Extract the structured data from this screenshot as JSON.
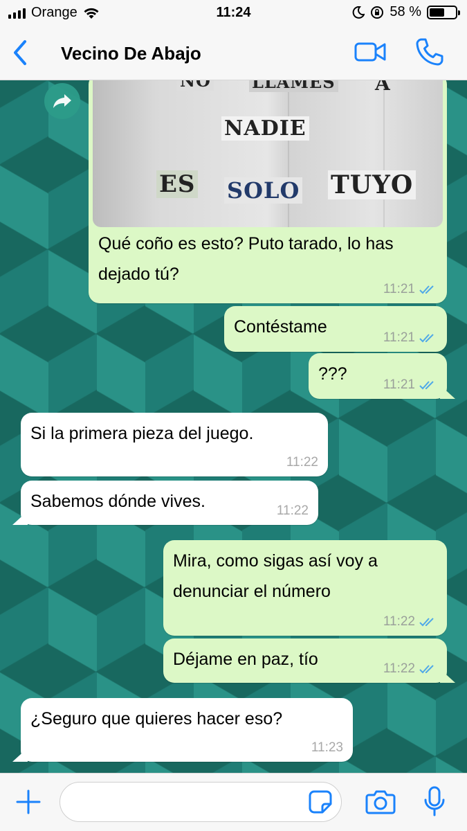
{
  "status_bar": {
    "carrier": "Orange",
    "time": "11:24",
    "battery_text": "58 %",
    "battery_level": 0.58
  },
  "header": {
    "back_icon": "chevron-left-icon",
    "contact_name": "Vecino De Abajo",
    "video_icon": "video-camera-icon",
    "call_icon": "phone-icon",
    "accent": "#1a82fb"
  },
  "image_message": {
    "photo_words": [
      "NO",
      "LLAMES",
      "A",
      "NADIE",
      "ES",
      "SOLO",
      "TUYO"
    ],
    "caption": "Qué coño es esto? Puto tarado, lo has dejado tú?",
    "time": "11:21"
  },
  "messages": [
    {
      "direction": "out",
      "text": "Contéstame",
      "time": "11:21",
      "read": true
    },
    {
      "direction": "out",
      "text": "???",
      "time": "11:21",
      "read": true
    },
    {
      "direction": "in",
      "text": "Si la primera pieza del juego.",
      "time": "11:22"
    },
    {
      "direction": "in",
      "text": "Sabemos dónde vives.",
      "time": "11:22"
    },
    {
      "direction": "out",
      "text": "Mira, como sigas así voy a denunciar el número",
      "time": "11:22",
      "read": true
    },
    {
      "direction": "out",
      "text": "Déjame en paz, tío",
      "time": "11:22",
      "read": true
    },
    {
      "direction": "in",
      "text": "¿Seguro que quieres hacer eso?",
      "time": "11:23"
    }
  ],
  "composer": {
    "value": "",
    "placeholder": "",
    "plus_icon": "plus-icon",
    "sticker_icon": "sticker-icon",
    "camera_icon": "camera-icon",
    "mic_icon": "microphone-icon"
  },
  "colors": {
    "outgoing_bubble": "#dcf8c6",
    "incoming_bubble": "#ffffff",
    "chat_background": "#1f7d75",
    "read_ticks": "#4fa8e8"
  }
}
